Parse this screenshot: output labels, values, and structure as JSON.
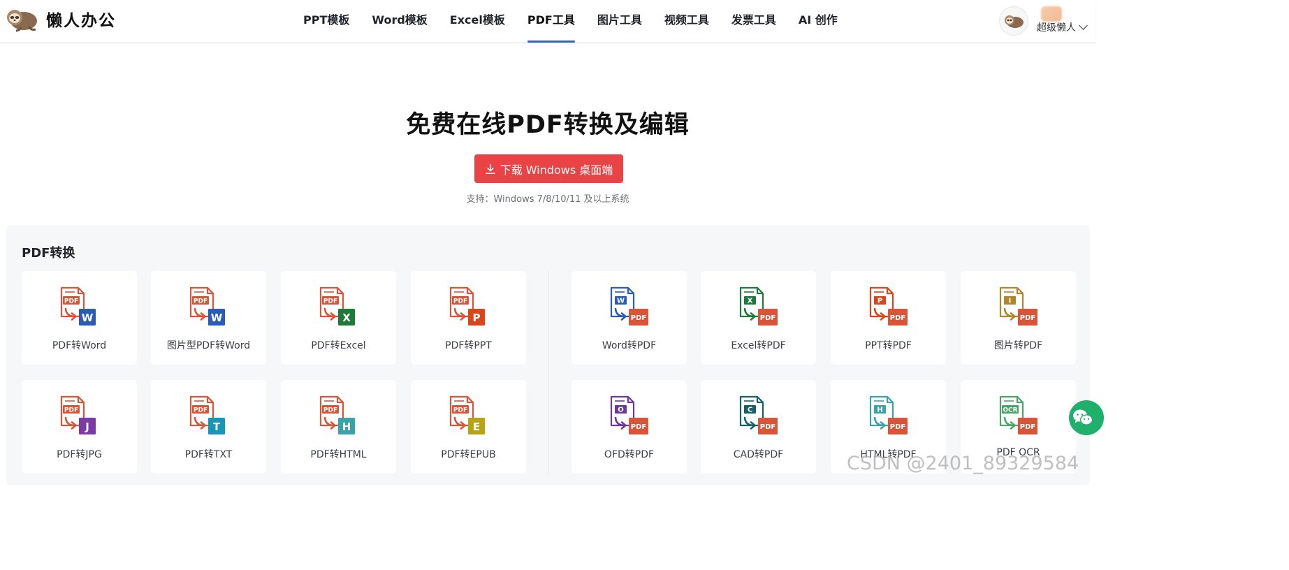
{
  "header": {
    "logo_text": "懒人办公",
    "nav": [
      {
        "label": "PPT模板",
        "active": false
      },
      {
        "label": "Word模板",
        "active": false
      },
      {
        "label": "Excel模板",
        "active": false
      },
      {
        "label": "PDF工具",
        "active": true
      },
      {
        "label": "图片工具",
        "active": false
      },
      {
        "label": "视频工具",
        "active": false
      },
      {
        "label": "发票工具",
        "active": false
      },
      {
        "label": "AI 创作",
        "active": false
      }
    ],
    "user_name": "超级懒人"
  },
  "hero": {
    "title": "免费在线PDF转换及编辑",
    "download_label": "下载 Windows 桌面端",
    "support_text": "支持：Windows 7/8/10/11 及以上系统"
  },
  "section": {
    "title": "PDF转换",
    "cards": [
      {
        "label": "PDF转Word",
        "mode": "from",
        "doc_color": "#d8553a",
        "sub_text": "PDF",
        "badge_text": "W",
        "badge_color": "#2a5bb8"
      },
      {
        "label": "图片型PDF转Word",
        "mode": "from",
        "doc_color": "#d8553a",
        "sub_text": "PDF",
        "badge_text": "W",
        "badge_color": "#2a5bb8"
      },
      {
        "label": "PDF转Excel",
        "mode": "from",
        "doc_color": "#d8553a",
        "sub_text": "PDF",
        "badge_text": "X",
        "badge_color": "#1f7a3a"
      },
      {
        "label": "PDF转PPT",
        "mode": "from",
        "doc_color": "#d8553a",
        "sub_text": "PDF",
        "badge_text": "P",
        "badge_color": "#d9461c"
      },
      {
        "label": "Word转PDF",
        "mode": "to",
        "doc_color": "#2a5bb8",
        "sub_text": "W",
        "badge_text": "PDF",
        "badge_color": "#d8553a"
      },
      {
        "label": "Excel转PDF",
        "mode": "to",
        "doc_color": "#1f7a3a",
        "sub_text": "X",
        "badge_text": "PDF",
        "badge_color": "#d8553a"
      },
      {
        "label": "PPT转PDF",
        "mode": "to",
        "doc_color": "#d9461c",
        "sub_text": "P",
        "badge_text": "PDF",
        "badge_color": "#d8553a"
      },
      {
        "label": "图片转PDF",
        "mode": "to",
        "doc_color": "#b0862a",
        "sub_text": "I",
        "badge_text": "PDF",
        "badge_color": "#d8553a"
      },
      {
        "label": "PDF转JPG",
        "mode": "from",
        "doc_color": "#d8553a",
        "sub_text": "PDF",
        "badge_text": "J",
        "badge_color": "#7b3aa8"
      },
      {
        "label": "PDF转TXT",
        "mode": "from",
        "doc_color": "#d8553a",
        "sub_text": "PDF",
        "badge_text": "T",
        "badge_color": "#1597b5"
      },
      {
        "label": "PDF转HTML",
        "mode": "from",
        "doc_color": "#d8553a",
        "sub_text": "PDF",
        "badge_text": "H",
        "badge_color": "#3aa3a8"
      },
      {
        "label": "PDF转EPUB",
        "mode": "from",
        "doc_color": "#d8553a",
        "sub_text": "PDF",
        "badge_text": "E",
        "badge_color": "#b6a316"
      },
      {
        "label": "OFD转PDF",
        "mode": "to",
        "doc_color": "#6b3a96",
        "sub_text": "O",
        "badge_text": "PDF",
        "badge_color": "#d8553a"
      },
      {
        "label": "CAD转PDF",
        "mode": "to",
        "doc_color": "#176065",
        "sub_text": "C",
        "badge_text": "PDF",
        "badge_color": "#d8553a"
      },
      {
        "label": "HTML转PDF",
        "mode": "to",
        "doc_color": "#3aa3a8",
        "sub_text": "H",
        "badge_text": "PDF",
        "badge_color": "#d8553a"
      },
      {
        "label": "PDF OCR",
        "mode": "to",
        "doc_color": "#4ba56a",
        "sub_text": "OCR",
        "badge_text": "PDF",
        "badge_color": "#d8553a"
      }
    ]
  },
  "watermark": "CSDN @2401_89329584",
  "colors": {
    "accent": "#2c62d6",
    "download": "#ea4345",
    "wechat": "#1fb06b",
    "pdf_red": "#d8553a"
  }
}
